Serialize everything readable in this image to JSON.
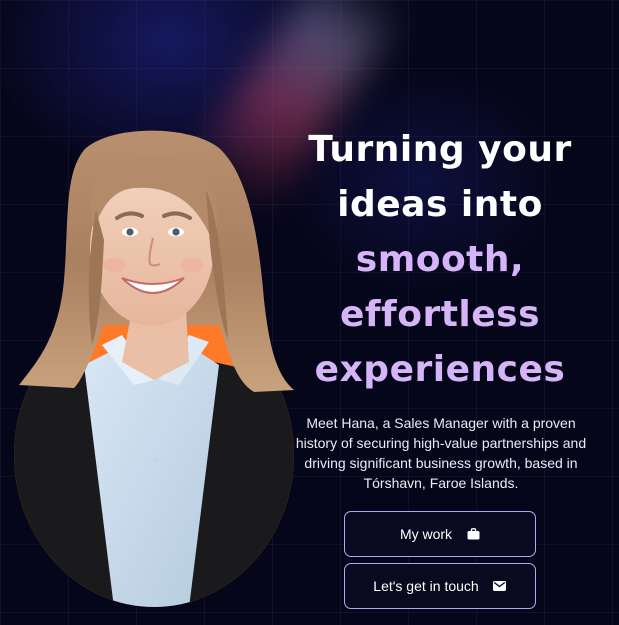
{
  "hero": {
    "headline_line1": "Turning your",
    "headline_line2": "ideas into",
    "headline_line3": "smooth,",
    "headline_line4": "effortless",
    "headline_line5": "experiences",
    "description": "Meet Hana, a Sales Manager with a proven history of securing high-value partnerships and driving significant business growth, based in Tórshavn, Faroe Islands."
  },
  "buttons": {
    "my_work_label": "My work",
    "my_work_icon": "briefcase-icon",
    "contact_label": "Let's get in touch",
    "contact_icon": "mail-icon"
  },
  "colors": {
    "background": "#06061a",
    "accent_purple": "#d5b4f7",
    "portrait_orange": "#ff7a28",
    "button_border": "#b8a6ee"
  }
}
